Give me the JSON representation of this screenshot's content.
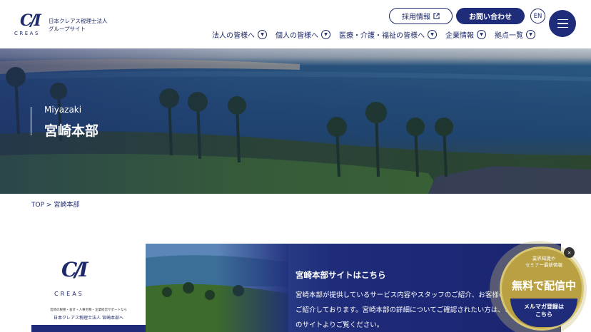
{
  "header": {
    "logo_text": "C/I",
    "logo_word": "CREAS",
    "logo_line1": "日本クレアス税理士法人",
    "logo_line2": "グループサイト",
    "recruit_label": "採用情報",
    "contact_label": "お問い合わせ",
    "en_label": "EN",
    "nav": [
      "法人の皆様へ",
      "個人の皆様へ",
      "医療・介護・福祉の皆様へ",
      "企業情報",
      "拠点一覧"
    ]
  },
  "hero": {
    "subtitle_en": "Miyazaki",
    "title": "宮崎本部"
  },
  "breadcrumb": {
    "top": "TOP",
    "sep": ">",
    "current": "宮崎本部"
  },
  "card": {
    "logo_text": "C/I",
    "logo_word": "CREAS",
    "small_text": "宮崎の税務・会計・人事労務・企業経営サポートなら",
    "name": "日本クレアス税理士法人 宮崎本部へ",
    "heading": "宮崎本部サイトはこちら",
    "body": "宮崎本部が提供しているサービス内容やスタッフのご紹介、お客様の声等をご紹介しております。宮崎本部の詳細についてご確認されたい方は、こちらのサイトよりご覧ください。"
  },
  "badge": {
    "small": "業界知識や\nセミナー最新情報",
    "big": "無料で配信中",
    "bottom": "メルマガ登録は\nこちら",
    "close": "×"
  }
}
